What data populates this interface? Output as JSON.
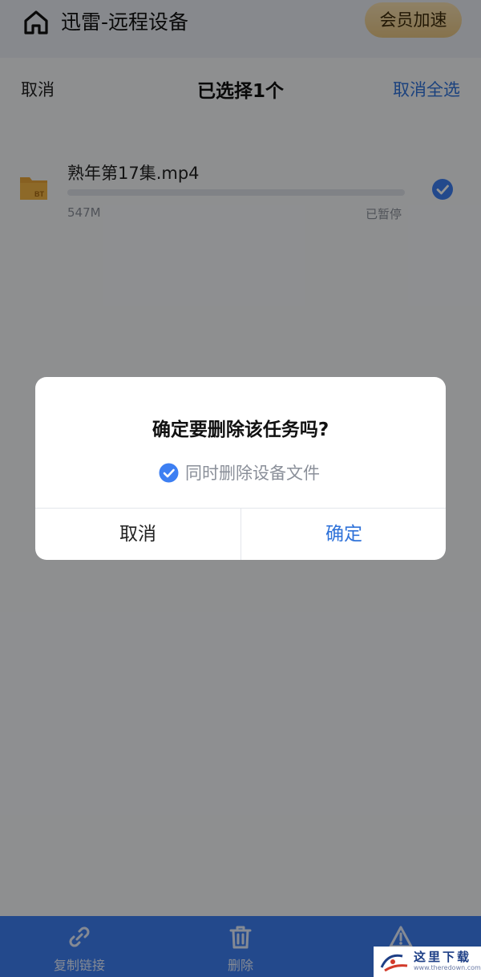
{
  "header": {
    "title": "迅雷-远程设备",
    "vip_label": "会员加速"
  },
  "selection_bar": {
    "cancel_label": "取消",
    "title": "已选择1个",
    "select_all_label": "取消全选"
  },
  "task": {
    "name": "熟年第17集.mp4",
    "size": "547M",
    "status": "已暂停",
    "progress": 0,
    "selected": true,
    "icon": "bt-folder-icon"
  },
  "bottom_bar": {
    "items": [
      {
        "label": "复制链接",
        "icon": "link-icon"
      },
      {
        "label": "删除",
        "icon": "trash-icon"
      },
      {
        "label": "",
        "icon": "warning-icon"
      }
    ]
  },
  "dialog": {
    "title": "确定要删除该任务吗?",
    "option_label": "同时删除设备文件",
    "option_checked": true,
    "cancel_label": "取消",
    "confirm_label": "确定"
  },
  "watermark": {
    "text": "这里下载",
    "url": "www.theredown.com"
  },
  "colors": {
    "accent": "#2f72d9",
    "bottom_bar": "#3d7ff2",
    "vip_gold": "#e6c584"
  }
}
